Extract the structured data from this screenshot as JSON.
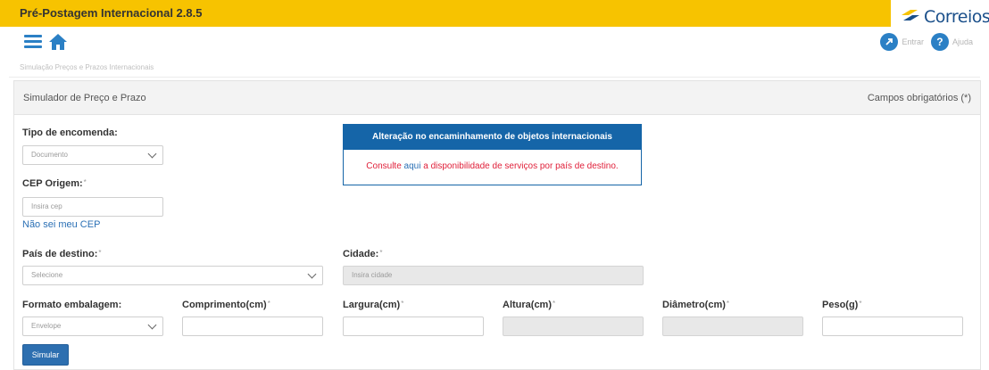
{
  "header": {
    "app_title": "Pré-Postagem Internacional 2.8.5",
    "logo_text": "Correios"
  },
  "nav": {
    "enter_label": "Entrar",
    "help_label": "Ajuda"
  },
  "breadcrumb": "Simulação Preços e Prazos Internacionais",
  "panel": {
    "title": "Simulador de Preço e Prazo",
    "required_note": "Campos obrigatórios (*)"
  },
  "form": {
    "tipo_label": "Tipo de encomenda:",
    "tipo_value": "Documento",
    "cep_label": "CEP Origem:",
    "cep_placeholder": "Insira cep",
    "cep_help_link": "Não sei meu CEP",
    "pais_label": "País de destino:",
    "pais_value": "Selecione",
    "cidade_label": "Cidade:",
    "cidade_placeholder": "Insira cidade",
    "formato_label": "Formato embalagem:",
    "formato_value": "Envelope",
    "comprimento_label": "Comprimento(cm)",
    "largura_label": "Largura(cm)",
    "altura_label": "Altura(cm)",
    "diametro_label": "Diâmetro(cm)",
    "peso_label": "Peso(g)",
    "required_mark": "*",
    "submit_label": "Simular"
  },
  "notice": {
    "title": "Alteração no encaminhamento de objetos internacionais",
    "text_before": "Consulte ",
    "link_text": "aqui",
    "text_after": " a disponibilidade de serviços por país de destino."
  },
  "colors": {
    "topbar": "#f7c300",
    "accent_blue": "#2b80c5",
    "notice_blue": "#1565a8",
    "notice_text_red": "#e0203a"
  }
}
